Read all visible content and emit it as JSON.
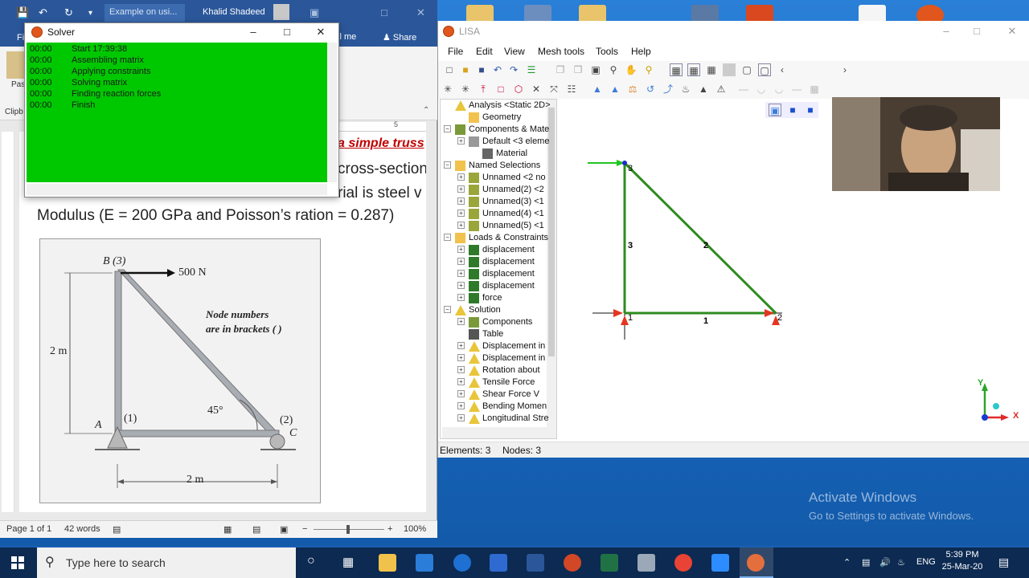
{
  "word": {
    "doc_name": "Example on usi...",
    "user": "Khalid Shadeed",
    "tab_file": "Fil",
    "tell_me": "ll me",
    "share": "Share",
    "paste": "Pas",
    "clipboard": "Clipb",
    "ruler_mark": "5",
    "line1": "a simple truss",
    "line2": "cross-section",
    "line3": "rial is steel v",
    "line4": "Modulus (E = 200 GPa and Poisson’s ration = 0.287)",
    "figure": {
      "node_b": "B",
      "node_b_num": "(3)",
      "force": "500 N",
      "note1": "Node numbers",
      "note2": "are in brackets ( )",
      "height": "2 m",
      "angle": "45°",
      "node_a": "A",
      "node_a_num": "(1)",
      "node_c_num": "(2)",
      "node_c": "C",
      "width": "2 m"
    },
    "status": {
      "page": "Page 1 of 1",
      "words": "42 words",
      "zoom": "100%"
    }
  },
  "solver": {
    "title": "Solver",
    "log": [
      {
        "time": "00:00",
        "msg": "Start 17:39:38"
      },
      {
        "time": "00:00",
        "msg": "Assembling matrix"
      },
      {
        "time": "00:00",
        "msg": "Applying constraints"
      },
      {
        "time": "00:00",
        "msg": "Solving matrix"
      },
      {
        "time": "00:00",
        "msg": "Finding reaction forces"
      },
      {
        "time": "00:00",
        "msg": "Finish"
      }
    ],
    "accent": "#00c800"
  },
  "lisa": {
    "title": "LISA",
    "menu": [
      "File",
      "Edit",
      "View",
      "Mesh tools",
      "Tools",
      "Help"
    ],
    "tree": [
      {
        "label": "Analysis <Static 2D>",
        "icon": "analysis-icon"
      },
      {
        "label": "Geometry",
        "icon": "folder-icon"
      },
      {
        "label": "Components & Mate",
        "icon": "components-icon"
      },
      {
        "label": "Default <3 eleme",
        "icon": "component-icon"
      },
      {
        "label": "Material",
        "icon": "material-icon"
      },
      {
        "label": "Named Selections",
        "icon": "folder-icon"
      },
      {
        "label": "Unnamed <2 no",
        "icon": "selection-icon"
      },
      {
        "label": "Unnamed(2) <2",
        "icon": "selection-icon"
      },
      {
        "label": "Unnamed(3) <1",
        "icon": "selection-icon"
      },
      {
        "label": "Unnamed(4) <1",
        "icon": "selection-icon"
      },
      {
        "label": "Unnamed(5) <1",
        "icon": "selection-icon"
      },
      {
        "label": "Loads & Constraints",
        "icon": "folder-icon"
      },
      {
        "label": "displacement",
        "icon": "constraint-icon"
      },
      {
        "label": "displacement",
        "icon": "constraint-icon"
      },
      {
        "label": "displacement",
        "icon": "constraint-icon"
      },
      {
        "label": "displacement",
        "icon": "constraint-icon"
      },
      {
        "label": "force",
        "icon": "force-icon"
      },
      {
        "label": "Solution",
        "icon": "solution-icon"
      },
      {
        "label": "Components",
        "icon": "components-icon"
      },
      {
        "label": "Table",
        "icon": "table-icon"
      },
      {
        "label": "Displacement in",
        "icon": "result-icon"
      },
      {
        "label": "Displacement in",
        "icon": "result-icon"
      },
      {
        "label": "Rotation about",
        "icon": "result-icon"
      },
      {
        "label": "Tensile Force",
        "icon": "result-icon"
      },
      {
        "label": "Shear Force V",
        "icon": "result-icon"
      },
      {
        "label": "Bending Momen",
        "icon": "result-icon"
      },
      {
        "label": "Longitudinal Stre",
        "icon": "result-icon"
      }
    ],
    "model": {
      "elements": [
        {
          "label": "1"
        },
        {
          "label": "2"
        },
        {
          "label": "3"
        }
      ],
      "nodes": [
        {
          "label": "1"
        },
        {
          "label": "2"
        },
        {
          "label": "3"
        }
      ],
      "element_color": "#2e8b1f",
      "support_color": "#e53522"
    },
    "axes": {
      "x": "X",
      "y": "Y"
    },
    "status": {
      "elements": "Elements: 3",
      "nodes": "Nodes: 3"
    }
  },
  "desktop": {
    "activate_title": "Activate Windows",
    "activate_sub": "Go to Settings to activate Windows."
  },
  "taskbar": {
    "search_placeholder": "Type here to search",
    "lang": "ENG",
    "time": "5:39 PM",
    "date": "25-Mar-20"
  }
}
